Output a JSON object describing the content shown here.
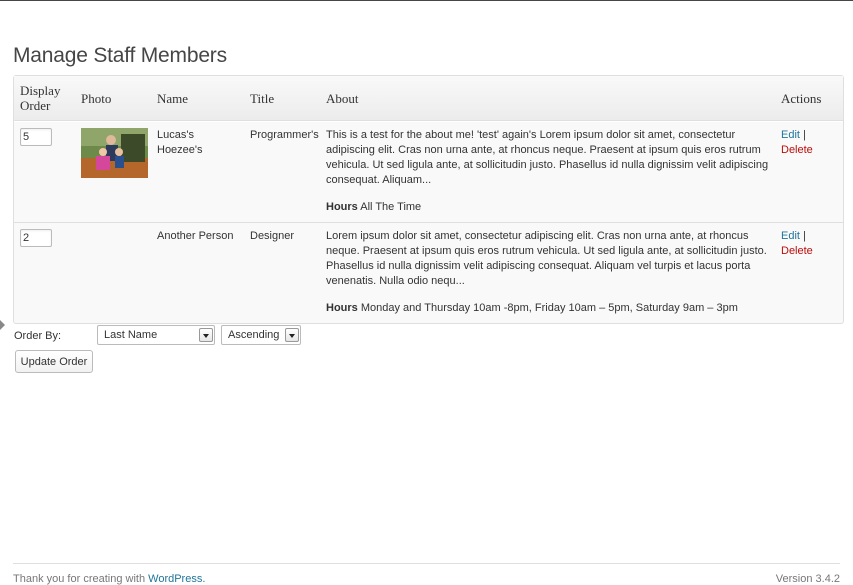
{
  "page": {
    "title": "Manage Staff Members"
  },
  "table": {
    "headers": {
      "display_order": "Display Order",
      "photo": "Photo",
      "name": "Name",
      "title": "Title",
      "about": "About",
      "actions": "Actions"
    },
    "rows": [
      {
        "order": "5",
        "has_photo": true,
        "name": "Lucas's Hoezee's",
        "title": "Programmer's",
        "about": "This is a test for the about me! 'test' again's Lorem ipsum dolor sit amet, consectetur adipiscing elit. Cras non urna ante, at rhoncus neque. Praesent at ipsum quis eros rutrum vehicula. Ut sed ligula ante, at sollicitudin justo. Phasellus id nulla dignissim velit adipiscing consequat. Aliquam...",
        "hours_label": "Hours",
        "hours": "All The Time",
        "edit_label": "Edit",
        "separator": "|",
        "delete_label": "Delete"
      },
      {
        "order": "2",
        "has_photo": false,
        "name": "Another Person",
        "title": "Designer",
        "about": "Lorem ipsum dolor sit amet, consectetur adipiscing elit. Cras non urna ante, at rhoncus neque. Praesent at ipsum quis eros rutrum vehicula. Ut sed ligula ante, at sollicitudin justo. Phasellus id nulla dignissim velit adipiscing consequat. Aliquam vel turpis et lacus porta venenatis. Nulla odio nequ...",
        "hours_label": "Hours",
        "hours": "Monday and Thursday 10am -8pm, Friday 10am – 5pm, Saturday 9am – 3pm",
        "edit_label": "Edit",
        "separator": "|",
        "delete_label": "Delete"
      }
    ]
  },
  "order_controls": {
    "label": "Order By:",
    "order_by_selected": "Last Name",
    "direction_selected": "Ascending",
    "update_button": "Update Order"
  },
  "footer": {
    "thanks_text": "Thank you for creating with",
    "wordpress_link": "WordPress.",
    "version": "Version 3.4.2"
  },
  "colors": {
    "link": "#21759b",
    "delete": "#bc0b0b",
    "title": "#464646"
  }
}
